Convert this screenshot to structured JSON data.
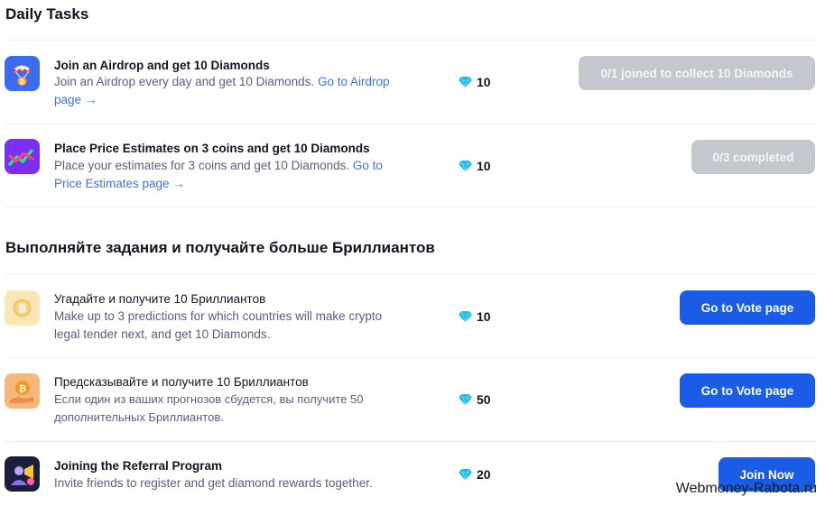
{
  "daily": {
    "title": "Daily Tasks",
    "tasks": [
      {
        "icon": "airdrop-parachute-icon",
        "title": "Join an Airdrop and get 10 Diamonds",
        "desc": "Join an Airdrop every day and get 10 Diamonds. ",
        "link_line1": "Go to Airdrop",
        "link_line2": "page →",
        "reward": "10",
        "button": "0/1 joined to collect 10 Diamonds"
      },
      {
        "icon": "price-chart-icon",
        "title": "Place Price Estimates on 3 coins and get 10 Diamonds",
        "desc": "Place your estimates for 3 coins and get 10 Diamonds. ",
        "link_line1": "Go to",
        "link_line2": "Price Estimates page →",
        "reward": "10",
        "button": "0/3 completed"
      }
    ]
  },
  "more": {
    "title": "Выполняйте задания и получайте больше Бриллиантов",
    "tasks": [
      {
        "icon": "bitcoin-coin-icon",
        "title": "Угадайте и получите 10 Бриллиантов",
        "desc_line1": "Make up to 3 predictions for which countries will make crypto",
        "desc_line2": "legal tender next, and get 10 Diamonds.",
        "reward": "10",
        "button": "Go to Vote page"
      },
      {
        "icon": "bitcoin-hand-icon",
        "title": "Предсказывайте и получите 10 Бриллиантов",
        "desc_line1": "Если один из ваших прогнозов сбудется, вы получите 50",
        "desc_line2": "дополнительных Бриллиантов.",
        "reward": "50",
        "button": "Go to Vote page"
      },
      {
        "icon": "referral-megaphone-icon",
        "title": "Joining the Referral Program",
        "desc_line1": "Invite friends to register and get diamond rewards together.",
        "reward": "20",
        "button": "Join Now"
      }
    ]
  },
  "watermark": "Webmoney-Rabota.ru",
  "colors": {
    "primary_button": "#1a5ce6",
    "disabled_button": "#c4c7ce",
    "link": "#3f6fe8",
    "diamond": "#1bb7e8"
  }
}
